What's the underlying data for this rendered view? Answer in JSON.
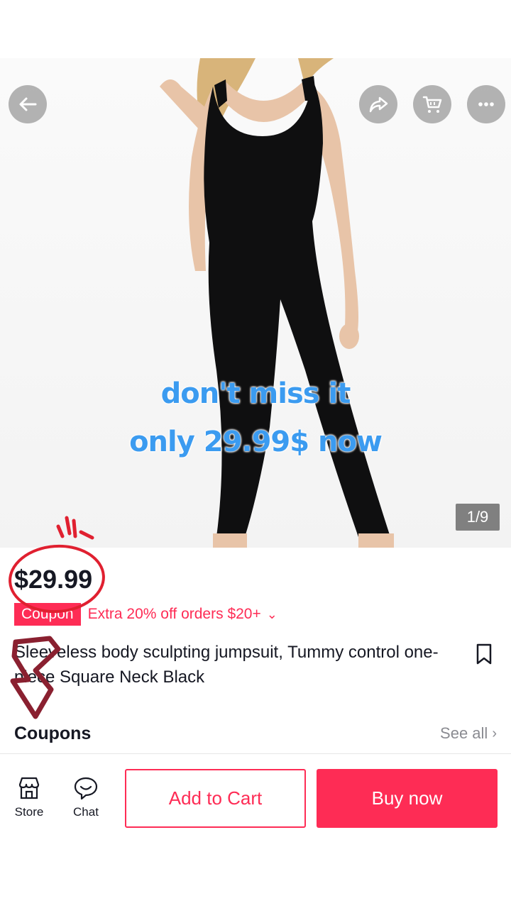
{
  "image": {
    "overlay_line1": "don't miss it",
    "overlay_line2": "only 29.99$ now",
    "counter": "1/9"
  },
  "product": {
    "price": "$29.99",
    "coupon_tag": "Coupon",
    "coupon_text": "Extra 20% off orders $20+",
    "title": "Sleeveless body sculpting jumpsuit, Tummy control one-piece Square Neck Black"
  },
  "coupons": {
    "label": "Coupons",
    "see_all": "See all"
  },
  "bottom_bar": {
    "store_label": "Store",
    "chat_label": "Chat",
    "add_to_cart": "Add to Cart",
    "buy_now": "Buy now"
  },
  "colors": {
    "accent": "#fe2c55",
    "overlay_text": "#3b9bf0",
    "annotation_red": "#e02030"
  },
  "icons": {
    "back": "back-arrow-icon",
    "share": "share-icon",
    "cart": "cart-icon",
    "more": "more-icon",
    "bookmark": "bookmark-icon",
    "store": "store-icon",
    "chat": "chat-icon"
  }
}
